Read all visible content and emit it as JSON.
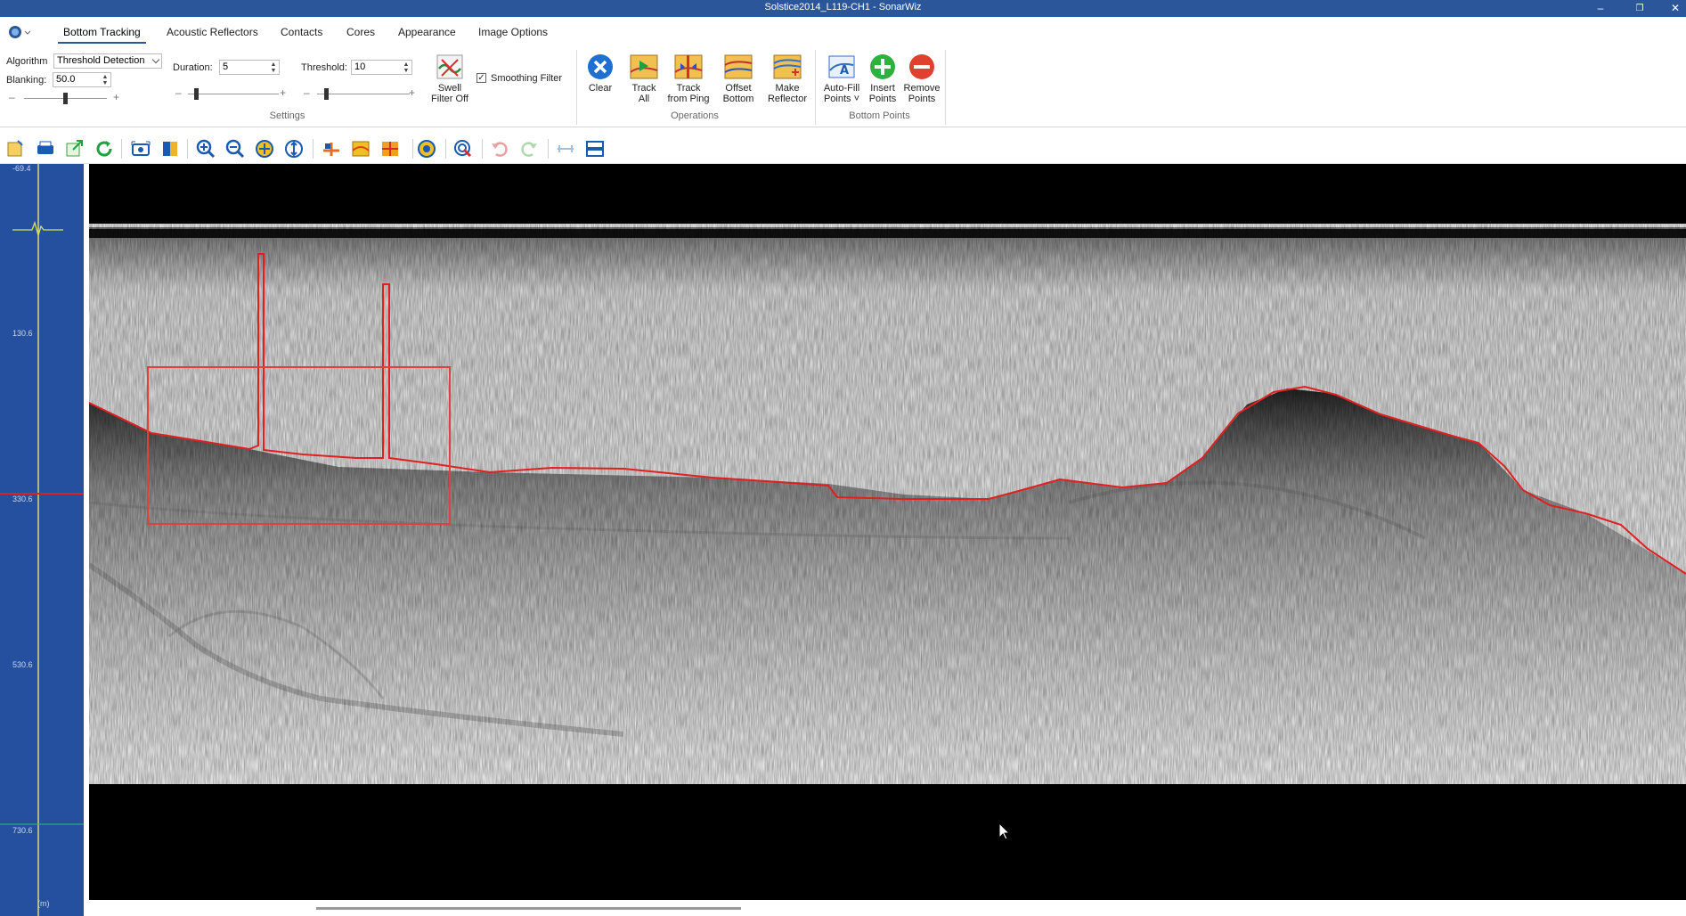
{
  "window": {
    "title": "Solstice2014_L119-CH1 - SonarWiz",
    "minimize": "–",
    "restore": "❐",
    "close": "✕"
  },
  "tabs": [
    {
      "label": "Bottom Tracking",
      "active": true
    },
    {
      "label": "Acoustic Reflectors"
    },
    {
      "label": "Contacts"
    },
    {
      "label": "Cores"
    },
    {
      "label": "Appearance"
    },
    {
      "label": "Image Options"
    }
  ],
  "settings": {
    "algorithm_label": "Algorithm",
    "algorithm_value": "Threshold Detection",
    "blanking_label": "Blanking:",
    "blanking_value": "50.0",
    "duration_label": "Duration:",
    "duration_value": "5",
    "threshold_label": "Threshold:",
    "threshold_value": "10",
    "swell_filter_line1": "Swell",
    "swell_filter_line2": "Filter Off",
    "smoothing_filter_label": "Smoothing Filter",
    "smoothing_filter_checked": true,
    "minus": "–",
    "plus": "+",
    "group_label": "Settings"
  },
  "operations": {
    "clear": "Clear",
    "track_all_1": "Track",
    "track_all_2": "All",
    "track_from_ping_1": "Track",
    "track_from_ping_2": "from Ping",
    "offset_bottom_1": "Offset",
    "offset_bottom_2": "Bottom",
    "make_reflector_1": "Make",
    "make_reflector_2": "Reflector",
    "group_label": "Operations"
  },
  "bottom_points": {
    "auto_fill_1": "Auto-Fill",
    "auto_fill_2": "Points ˅",
    "insert_1": "Insert",
    "insert_2": "Points",
    "remove_1": "Remove",
    "remove_2": "Points",
    "group_label": "Bottom Points"
  },
  "depth_scale": {
    "ticks": [
      "-69.4",
      "130.6",
      "330.6",
      "530.6",
      "730.6"
    ],
    "unit": "(m)"
  },
  "colors": {
    "accent": "#2b579a",
    "depth_bg": "#2550a0",
    "bottom_trace": "#e02020",
    "selection": "#e04040"
  }
}
